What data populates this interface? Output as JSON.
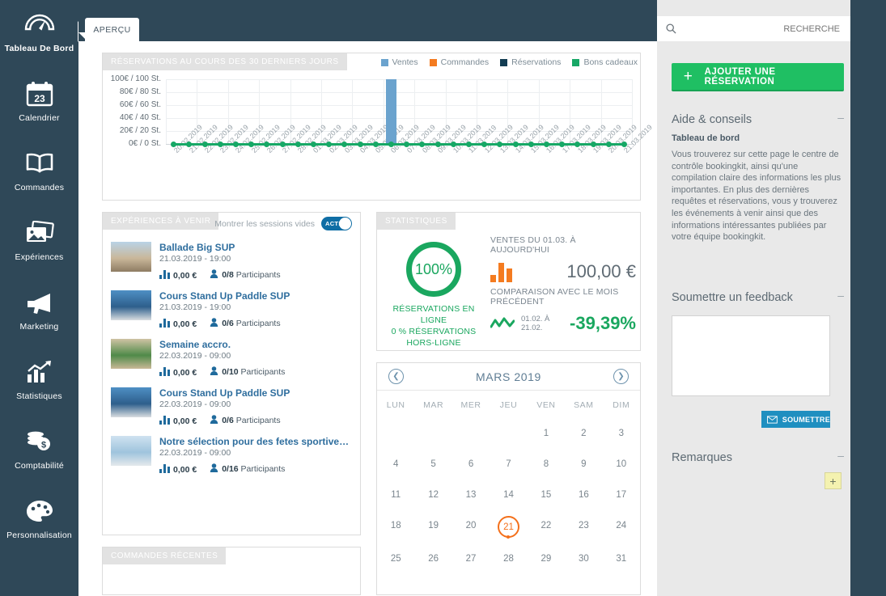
{
  "sidebar": {
    "items": [
      {
        "label": "Tableau De Bord",
        "icon": "gauge-icon",
        "active": true
      },
      {
        "label": "Calendrier",
        "icon": "calendar-icon",
        "badge": "23",
        "active": false
      },
      {
        "label": "Commandes",
        "icon": "book-icon",
        "active": false
      },
      {
        "label": "Expériences",
        "icon": "photos-icon",
        "active": false
      },
      {
        "label": "Marketing",
        "icon": "megaphone-icon",
        "active": false
      },
      {
        "label": "Statistiques",
        "icon": "chart-arrow-icon",
        "active": false
      },
      {
        "label": "Comptabilité",
        "icon": "coins-icon",
        "active": false
      },
      {
        "label": "Personnalisation",
        "icon": "palette-icon",
        "active": false
      }
    ]
  },
  "tabs": [
    {
      "label": "APERÇU",
      "active": true
    }
  ],
  "search": {
    "placeholder": "RECHERCHE",
    "value": "",
    "icon": "search-icon"
  },
  "chart_data": {
    "type": "bar",
    "title": "RÉSERVATIONS AU COURS DES 30 DERNIERS JOURS",
    "xlabel": "",
    "ylabel": "",
    "ylim": [
      0,
      100
    ],
    "yticks": [
      0,
      20,
      40,
      60,
      80,
      100
    ],
    "ytick_labels": [
      "0€ / 0 St.",
      "20€ / 20 St.",
      "40€ / 40 St.",
      "60€ / 60 St.",
      "80€ / 80 St.",
      "100€ / 100 St."
    ],
    "grid": true,
    "legend_position": "top-right",
    "categories": [
      "20.02.2019",
      "21.02.2019",
      "22.02.2019",
      "23.02.2019",
      "24.02.2019",
      "25.02.2019",
      "26.02.2019",
      "27.02.2019",
      "28.02.2019",
      "01.03.2019",
      "02.03.2019",
      "03.03.2019",
      "04.03.2019",
      "05.03.2019",
      "06.03.2019",
      "07.03.2019",
      "08.03.2019",
      "09.03.2019",
      "10.03.2019",
      "11.03.2019",
      "12.03.2019",
      "13.03.2019",
      "14.03.2019",
      "15.03.2019",
      "16.03.2019",
      "17.03.2019",
      "18.03.2019",
      "19.03.2019",
      "20.03.2019",
      "21.03.2019"
    ],
    "series": [
      {
        "name": "Ventes",
        "color": "#6ba3ce",
        "type": "bar",
        "values": [
          0,
          0,
          0,
          0,
          0,
          0,
          0,
          0,
          0,
          0,
          0,
          0,
          0,
          0,
          100,
          0,
          0,
          0,
          0,
          0,
          0,
          0,
          0,
          0,
          0,
          0,
          0,
          0,
          0,
          0
        ]
      },
      {
        "name": "Commandes",
        "color": "#f47b20",
        "type": "bar",
        "values": [
          0,
          0,
          0,
          0,
          0,
          0,
          0,
          0,
          0,
          0,
          0,
          0,
          0,
          0,
          0,
          0,
          0,
          0,
          0,
          0,
          0,
          0,
          0,
          0,
          0,
          0,
          0,
          0,
          0,
          0
        ]
      },
      {
        "name": "Réservations",
        "color": "#123c52",
        "type": "bar",
        "values": [
          0,
          0,
          0,
          0,
          0,
          0,
          0,
          0,
          0,
          0,
          0,
          0,
          0,
          0,
          0,
          0,
          0,
          0,
          0,
          0,
          0,
          0,
          0,
          0,
          0,
          0,
          0,
          0,
          0,
          0
        ]
      },
      {
        "name": "Bons cadeaux",
        "color": "#17a866",
        "type": "line",
        "values": [
          0,
          0,
          0,
          0,
          0,
          0,
          0,
          0,
          0,
          0,
          0,
          0,
          0,
          0,
          0,
          0,
          0,
          0,
          0,
          0,
          0,
          0,
          0,
          0,
          0,
          0,
          0,
          0,
          0,
          0
        ]
      }
    ]
  },
  "experiences": {
    "panel_title": "EXPÉRIENCES À VENIR",
    "toggle_label": "Montrer les sessions vides",
    "toggle_state": "ACTIF",
    "participants_word": "Participants",
    "items": [
      {
        "title": "Ballade Big SUP",
        "date": "21.03.2019 - 19:00",
        "price": "0,00 €",
        "participants": "0/8"
      },
      {
        "title": "Cours Stand Up Paddle SUP",
        "date": "21.03.2019 - 19:00",
        "price": "0,00 €",
        "participants": "0/6"
      },
      {
        "title": "Semaine accro.",
        "date": "22.03.2019 - 09:00",
        "price": "0,00 €",
        "participants": "0/10"
      },
      {
        "title": "Cours Stand Up Paddle SUP",
        "date": "22.03.2019 - 09:00",
        "price": "0,00 €",
        "participants": "0/6"
      },
      {
        "title": "Notre sélection pour des fetes sportives: C…",
        "date": "22.03.2019 - 09:00",
        "price": "0,00 €",
        "participants": "0/16"
      }
    ]
  },
  "recent_orders": {
    "panel_title": "COMMANDES RÉCENTES"
  },
  "statistics": {
    "panel_title": "STATISTIQUES",
    "donut_value": "100%",
    "donut_caption_line1": "RÉSERVATIONS EN LIGNE",
    "donut_caption_line2": "0 % RÉSERVATIONS HORS-LIGNE",
    "sales_label": "VENTES DU 01.03. À AUJOURD'HUI",
    "sales_value": "100,00 €",
    "compare_label": "COMPARAISON AVEC LE MOIS PRÉCÉDENT",
    "compare_range": "01.02. À 21.02.",
    "compare_value": "-39,39%"
  },
  "calendar": {
    "title": "MARS 2019",
    "prev_icon": "chevron-left-icon",
    "next_icon": "chevron-right-icon",
    "dow": [
      "LUN",
      "MAR",
      "MER",
      "JEU",
      "VEN",
      "SAM",
      "DIM"
    ],
    "leading_blanks": 4,
    "days": [
      1,
      2,
      3,
      4,
      5,
      6,
      7,
      8,
      9,
      10,
      11,
      12,
      13,
      14,
      15,
      16,
      17,
      18,
      19,
      20,
      21,
      22,
      23,
      24,
      25,
      26,
      27,
      28,
      29,
      30,
      31
    ],
    "today": 21
  },
  "right": {
    "add_button": {
      "label": "AJOUTER UNE RÉSERVATION",
      "icon": "plus-icon"
    },
    "help": {
      "title": "Aide & conseils",
      "subtitle": "Tableau de bord",
      "body": "Vous trouverez sur cette page le centre de contrôle bookingkit, ainsi qu'une compilation claire des informations les plus importantes. En plus des dernières requêtes et réservations, vous y trouverez les événements à venir ainsi que des informations intéressantes publiées par votre équipe bookingkit.",
      "collapse_icon": "minus-icon"
    },
    "feedback": {
      "title": "Soumettre un feedback",
      "value": "",
      "submit_label": "SOUMETTRE",
      "submit_icon": "envelope-icon",
      "collapse_icon": "minus-icon"
    },
    "notes": {
      "title": "Remarques",
      "add_icon": "plus-icon",
      "collapse_icon": "minus-icon"
    }
  },
  "colors": {
    "navy": "#2f4858",
    "green": "#1fbf63",
    "blue": "#6ba3ce",
    "orange": "#f4701b",
    "panel_tab_grey": "#e2e2e2"
  }
}
